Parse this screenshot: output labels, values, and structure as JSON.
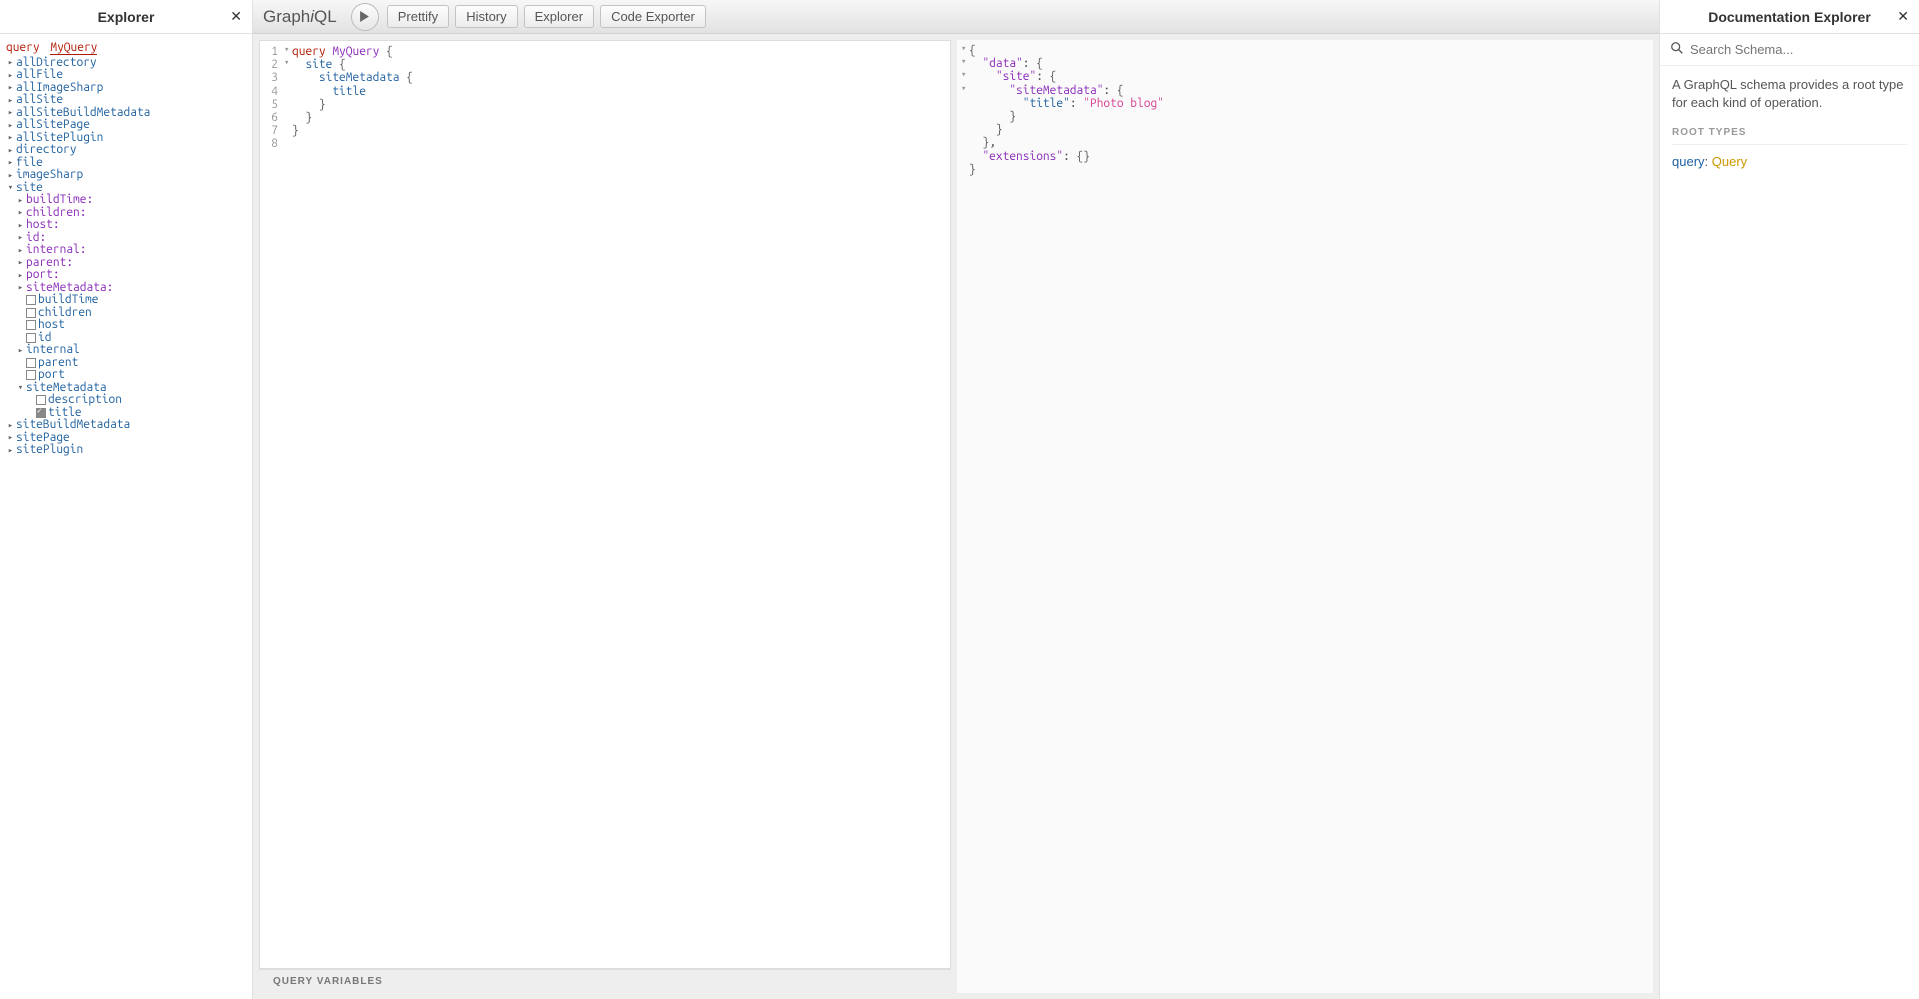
{
  "explorer": {
    "title": "Explorer",
    "query_kw": "query",
    "query_name": "MyQuery",
    "top_nodes": [
      "allDirectory",
      "allFile",
      "allImageSharp",
      "allSite",
      "allSiteBuildMetadata",
      "allSitePage",
      "allSitePlugin",
      "directory",
      "file",
      "imageSharp"
    ],
    "site_label": "site",
    "site_arg_nodes": [
      "buildTime:",
      "children:",
      "host:",
      "id:",
      "internal:",
      "parent:",
      "port:",
      "siteMetadata:"
    ],
    "site_field_checkboxes": [
      "buildTime",
      "children",
      "host",
      "id"
    ],
    "site_internal": "internal",
    "site_field_checkboxes2": [
      "parent",
      "port"
    ],
    "siteMetadata_label": "siteMetadata",
    "siteMetadata_children": [
      {
        "label": "description",
        "checked": false
      },
      {
        "label": "title",
        "checked": true
      }
    ],
    "bottom_nodes": [
      "siteBuildMetadata",
      "sitePage",
      "sitePlugin"
    ]
  },
  "topbar": {
    "logo_a": "Graph",
    "logo_i": "i",
    "logo_b": "QL",
    "buttons": [
      "Prettify",
      "History",
      "Explorer",
      "Code Exporter"
    ]
  },
  "query_lines": [
    {
      "n": "1",
      "fold": "▾",
      "tokens": [
        [
          "kw",
          "query "
        ],
        [
          "def",
          "MyQuery"
        ],
        [
          "punc",
          " {"
        ]
      ]
    },
    {
      "n": "2",
      "fold": "▾",
      "tokens": [
        [
          "punc",
          "  "
        ],
        [
          "field",
          "site"
        ],
        [
          "punc",
          " {"
        ]
      ]
    },
    {
      "n": "3",
      "fold": "",
      "tokens": [
        [
          "punc",
          "    "
        ],
        [
          "field",
          "siteMetadata"
        ],
        [
          "punc",
          " {"
        ]
      ]
    },
    {
      "n": "4",
      "fold": "",
      "tokens": [
        [
          "punc",
          "      "
        ],
        [
          "field",
          "title"
        ]
      ]
    },
    {
      "n": "5",
      "fold": "",
      "tokens": [
        [
          "punc",
          "    }"
        ]
      ]
    },
    {
      "n": "6",
      "fold": "",
      "tokens": [
        [
          "punc",
          "  }"
        ]
      ]
    },
    {
      "n": "7",
      "fold": "",
      "tokens": [
        [
          "punc",
          "}"
        ]
      ]
    },
    {
      "n": "8",
      "fold": "",
      "tokens": []
    }
  ],
  "result_lines": [
    {
      "fold": "▾",
      "tokens": [
        [
          "punc",
          "{"
        ]
      ]
    },
    {
      "fold": "▾",
      "tokens": [
        [
          "punc",
          "  "
        ],
        [
          "prop",
          "\"data\""
        ],
        [
          "punc",
          ": {"
        ]
      ]
    },
    {
      "fold": "▾",
      "tokens": [
        [
          "punc",
          "    "
        ],
        [
          "prop",
          "\"site\""
        ],
        [
          "punc",
          ": {"
        ]
      ]
    },
    {
      "fold": "▾",
      "tokens": [
        [
          "punc",
          "      "
        ],
        [
          "prop",
          "\"siteMetadata\""
        ],
        [
          "punc",
          ": {"
        ]
      ]
    },
    {
      "fold": "",
      "tokens": [
        [
          "punc",
          "        "
        ],
        [
          "attr",
          "\"title\""
        ],
        [
          "punc",
          ": "
        ],
        [
          "str",
          "\"Photo blog\""
        ]
      ]
    },
    {
      "fold": "",
      "tokens": [
        [
          "punc",
          "      }"
        ]
      ]
    },
    {
      "fold": "",
      "tokens": [
        [
          "punc",
          "    }"
        ]
      ]
    },
    {
      "fold": "",
      "tokens": [
        [
          "punc",
          "  },"
        ]
      ]
    },
    {
      "fold": "",
      "tokens": [
        [
          "punc",
          "  "
        ],
        [
          "prop",
          "\"extensions\""
        ],
        [
          "punc",
          ": {}"
        ]
      ]
    },
    {
      "fold": "",
      "tokens": [
        [
          "punc",
          "}"
        ]
      ]
    }
  ],
  "vars_label": "QUERY VARIABLES",
  "docs": {
    "title": "Documentation Explorer",
    "search_placeholder": "Search Schema...",
    "description": "A GraphQL schema provides a root type for each kind of operation.",
    "section": "ROOT TYPES",
    "root_label": "query",
    "root_type": "Query"
  }
}
